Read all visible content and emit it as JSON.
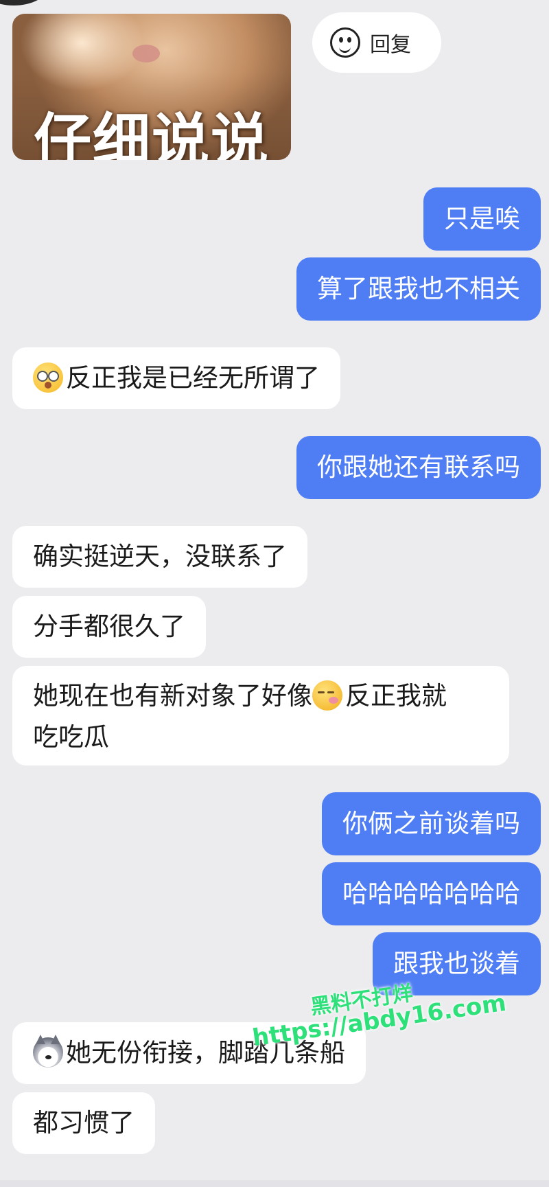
{
  "sticker": {
    "text": "仔细说说"
  },
  "reply_button": {
    "label": "回复",
    "icon": "smiley-face-icon"
  },
  "messages": [
    {
      "side": "out",
      "text": "只是唉"
    },
    {
      "side": "out",
      "text": "算了跟我也不相关"
    },
    {
      "side": "in",
      "emoji": "dizzy-face-emoji",
      "text": "反正我是已经无所谓了"
    },
    {
      "side": "out",
      "text": "你跟她还有联系吗"
    },
    {
      "side": "in",
      "text": "确实挺逆天，没联系了"
    },
    {
      "side": "in",
      "text": "分手都很久了"
    },
    {
      "side": "in",
      "text_before": "她现在也有新对象了好像",
      "emoji": "blowing-kiss-emoji",
      "text_after": "反正我就",
      "text_line2": "吃吃瓜"
    },
    {
      "side": "out",
      "text": "你俩之前谈着吗"
    },
    {
      "side": "out",
      "text": "哈哈哈哈哈哈哈"
    },
    {
      "side": "out",
      "text": "跟我也谈着"
    },
    {
      "side": "in",
      "emoji": "husky-dog-emoji",
      "text": "她无份衔接，脚踏几条船"
    },
    {
      "side": "in",
      "text": "都习惯了"
    }
  ],
  "watermark": {
    "line1": "黑料不打烊",
    "line2": "https://abdy16.com"
  },
  "colors": {
    "outgoing_bubble": "#4f7df4",
    "incoming_bubble": "#ffffff",
    "background": "#ececef",
    "watermark": "#2ee07a"
  }
}
